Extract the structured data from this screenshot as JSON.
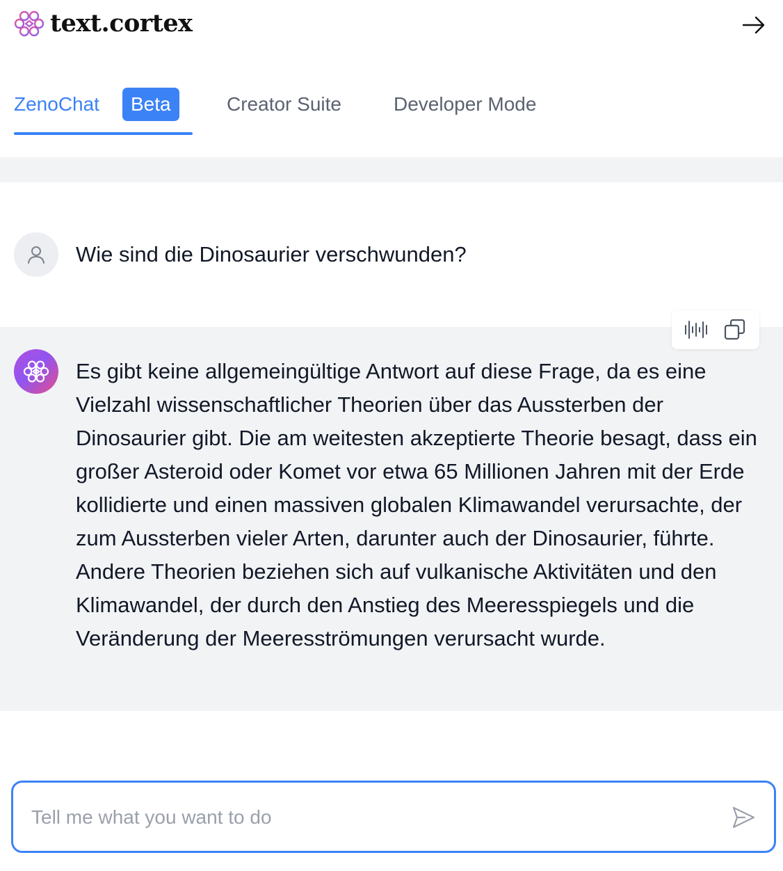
{
  "brand": {
    "name": "text.cortex",
    "icon": "brain-icon"
  },
  "header": {
    "collapse_icon": "arrow-right-icon"
  },
  "tabs": [
    {
      "label": "ZenoChat",
      "badge": "Beta",
      "active": true
    },
    {
      "label": "Creator Suite",
      "active": false
    },
    {
      "label": "Developer Mode",
      "active": false
    }
  ],
  "conversation": {
    "user_message": {
      "avatar_icon": "user-icon",
      "text": "Wie sind die Dinosaurier verschwunden?"
    },
    "ai_message": {
      "avatar_icon": "brain-icon",
      "text": "Es gibt keine allgemeingültige Antwort auf diese Frage, da es eine Vielzahl wissenschaftlicher Theorien über das Aussterben der Dinosaurier gibt. Die am weitesten akzeptierte Theorie besagt, dass ein großer Asteroid oder Komet vor etwa 65 Millionen Jahren mit der Erde kollidierte und einen massiven globalen Klimawandel verursachte, der zum Aussterben vieler Arten, darunter auch der Dinosaurier, führte. Andere Theorien beziehen sich auf vulkanische Aktivitäten und den Klimawandel, der durch den Anstieg des Meeresspiegels und die Veränderung der Meeresströmungen verursacht wurde.",
      "actions": [
        "audio-waveform-icon",
        "copy-icon"
      ]
    }
  },
  "composer": {
    "value": "",
    "placeholder": "Tell me what you want to do",
    "send_icon": "send-icon"
  },
  "colors": {
    "accent": "#3b82f6",
    "panel_bg": "#f2f3f5",
    "avatar_gradient_start": "#b04fe0",
    "avatar_gradient_end": "#e34d8d"
  }
}
